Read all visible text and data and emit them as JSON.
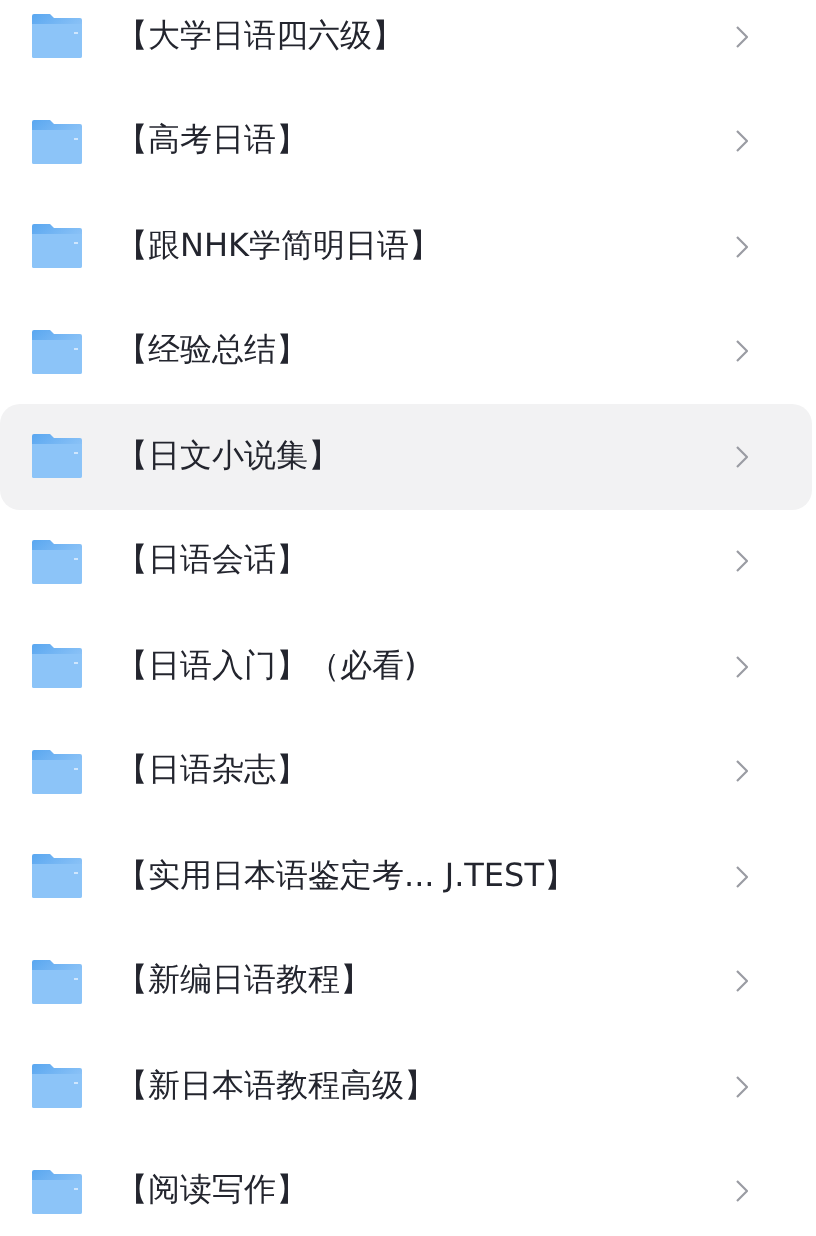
{
  "folders": [
    {
      "name": "【大学日语四六级】",
      "selected": false
    },
    {
      "name": "【高考日语】",
      "selected": false
    },
    {
      "name": "【跟NHK学简明日语】",
      "selected": false
    },
    {
      "name": "【经验总结】",
      "selected": false
    },
    {
      "name": "【日文小说集】",
      "selected": true
    },
    {
      "name": "【日语会话】",
      "selected": false
    },
    {
      "name": "【日语入门】（必看)",
      "selected": false
    },
    {
      "name": "【日语杂志】",
      "selected": false
    },
    {
      "name": "【实用日本语鉴定考...  J.TEST】",
      "selected": false
    },
    {
      "name": "【新编日语教程】",
      "selected": false
    },
    {
      "name": "【新日本语教程高级】",
      "selected": false
    },
    {
      "name": "【阅读写作】",
      "selected": false
    }
  ]
}
